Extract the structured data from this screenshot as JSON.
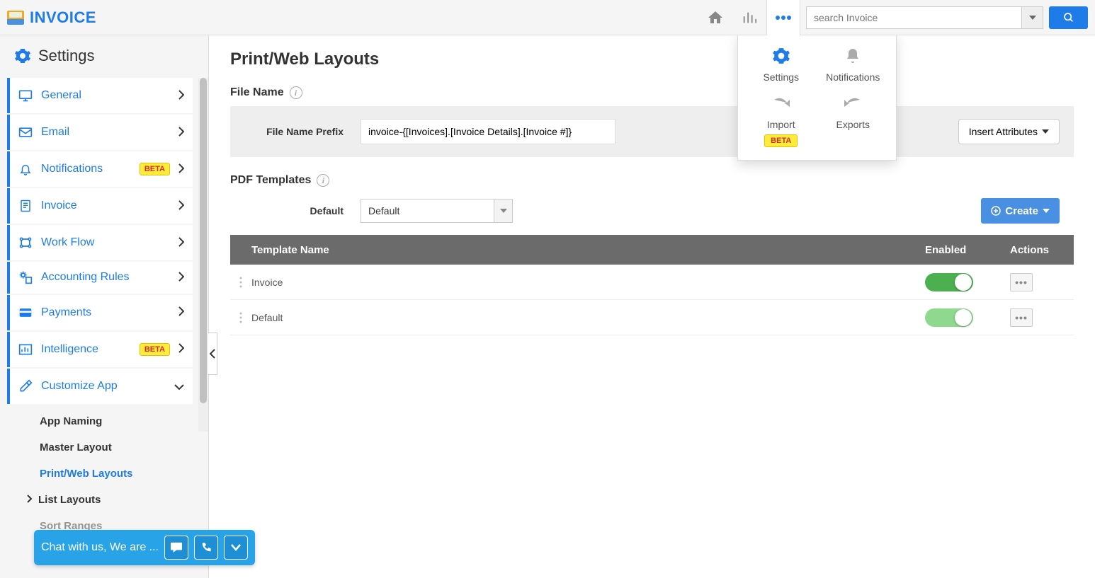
{
  "app": {
    "name": "INVOICE"
  },
  "search": {
    "placeholder": "search Invoice"
  },
  "dropdown_panel": {
    "items": [
      {
        "label": "Settings",
        "icon": "gear"
      },
      {
        "label": "Notifications",
        "icon": "bell"
      },
      {
        "label": "Import",
        "icon": "redo",
        "badge": "BETA"
      },
      {
        "label": "Exports",
        "icon": "undo"
      }
    ]
  },
  "sidebar": {
    "title": "Settings",
    "items": [
      {
        "label": "General",
        "icon": "monitor"
      },
      {
        "label": "Email",
        "icon": "mail"
      },
      {
        "label": "Notifications",
        "icon": "bell",
        "badge": "BETA"
      },
      {
        "label": "Invoice",
        "icon": "document"
      },
      {
        "label": "Work Flow",
        "icon": "workflow"
      },
      {
        "label": "Accounting Rules",
        "icon": "gear-doc"
      },
      {
        "label": "Payments",
        "icon": "card"
      },
      {
        "label": "Intelligence",
        "icon": "chart",
        "badge": "BETA"
      },
      {
        "label": "Customize App",
        "icon": "tools",
        "expanded": true
      }
    ],
    "sub_items": [
      {
        "label": "App Naming"
      },
      {
        "label": "Master Layout"
      },
      {
        "label": "Print/Web Layouts",
        "active": true
      },
      {
        "label": "List Layouts",
        "has_sub": true
      },
      {
        "label": "Sort Ranges"
      }
    ]
  },
  "main": {
    "page_title": "Print/Web Layouts",
    "file_name_section": "File Name",
    "file_name_prefix_label": "File Name Prefix",
    "file_name_prefix_value": "invoice-{[Invoices].[Invoice Details].[Invoice #]}",
    "insert_attributes_btn": "Insert Attributes",
    "pdf_templates_section": "PDF Templates",
    "default_label": "Default",
    "default_selected": "Default",
    "create_btn": "Create",
    "table": {
      "headers": {
        "name": "Template Name",
        "enabled": "Enabled",
        "actions": "Actions"
      },
      "rows": [
        {
          "name": "Invoice",
          "enabled": true,
          "enabled_strong": true
        },
        {
          "name": "Default",
          "enabled": true,
          "enabled_strong": false
        }
      ]
    }
  },
  "chat": {
    "text": "Chat with us, We are ..."
  }
}
